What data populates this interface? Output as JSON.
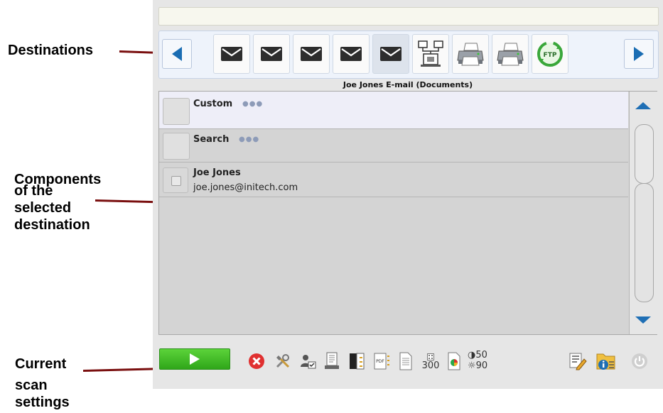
{
  "callouts": {
    "destinations": "Destinations",
    "components": [
      "Components",
      "of the",
      "selected",
      "destination"
    ],
    "scan_settings": [
      "Current",
      "scan",
      "settings"
    ]
  },
  "destinations": {
    "items": [
      {
        "icon": "envelope-icon"
      },
      {
        "icon": "envelope-icon"
      },
      {
        "icon": "envelope-icon"
      },
      {
        "icon": "envelope-icon"
      },
      {
        "icon": "envelope-icon",
        "selected": true
      },
      {
        "icon": "network-folder-icon"
      },
      {
        "icon": "printer-icon"
      },
      {
        "icon": "printer-icon"
      },
      {
        "icon": "ftp-icon",
        "label": "FTP"
      }
    ],
    "selected_title": "Joe Jones E-mail (Documents)"
  },
  "components": [
    {
      "title": "Custom",
      "subtitle": "",
      "dots": "●●●",
      "selected": true
    },
    {
      "title": "Search",
      "subtitle": "",
      "dots": "●●●"
    },
    {
      "title": "Joe Jones",
      "subtitle": "joe.jones@initech.com",
      "dots": ""
    }
  ],
  "scan_settings": {
    "resolution": "300",
    "brightness": "50",
    "contrast": "90",
    "pdf_label": "PDF"
  },
  "colors": {
    "callout_line": "#7a0f0f",
    "accent_blue": "#1a6db3",
    "go_green": "#2fa619",
    "cancel_red": "#e03030"
  }
}
